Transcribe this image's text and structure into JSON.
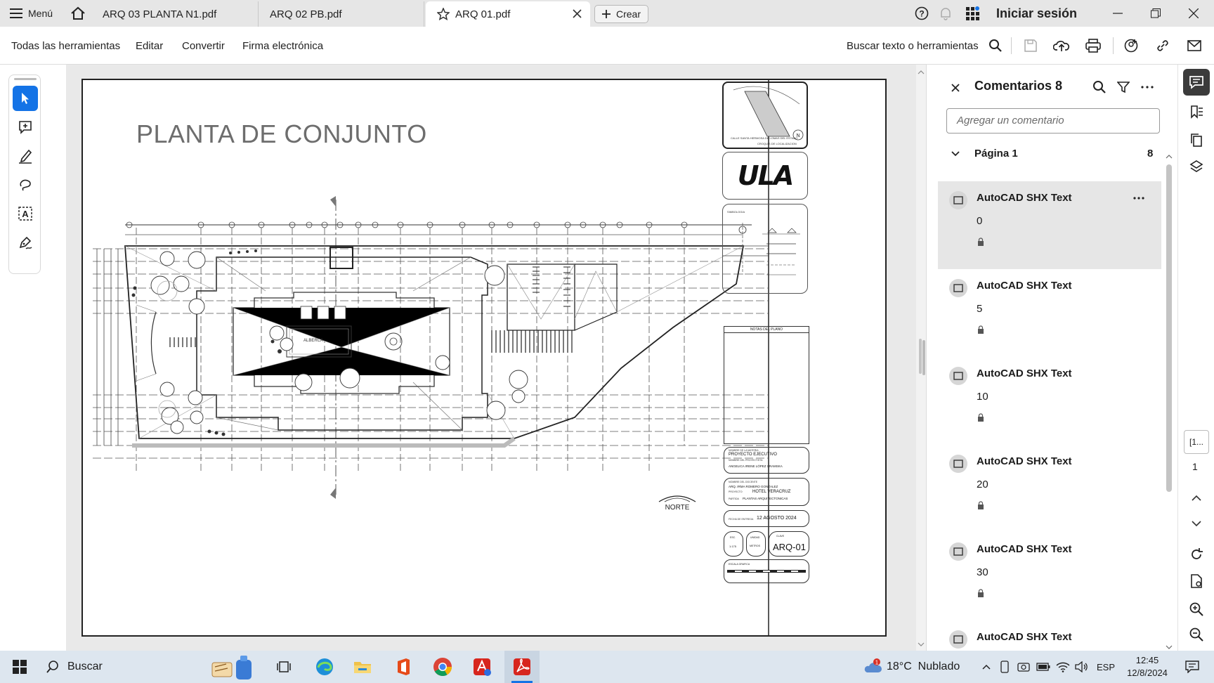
{
  "titlebar": {
    "menu_label": "Menú",
    "tabs": [
      {
        "label": "ARQ 03 PLANTA N1.pdf"
      },
      {
        "label": "ARQ 02  PB.pdf"
      },
      {
        "label": "ARQ 01.pdf"
      }
    ],
    "create_label": "Crear",
    "signin_label": "Iniciar sesión"
  },
  "toolbar": {
    "items": [
      "Todas las herramientas",
      "Editar",
      "Convertir",
      "Firma electrónica"
    ],
    "search_label": "Buscar texto o herramientas"
  },
  "document": {
    "title": "PLANTA DE CONJUNTO",
    "labels": {
      "alberca": "ALBERCA",
      "norte": "NORTE",
      "notas": "NOTAS DEL PLANO",
      "proyecto": "PROYECTO EJECUTIVO",
      "autor": "ANGELICA IRENE LÓPEZ SRAMSKA",
      "docente": "ARQ. IRMA ROMERO GONZALEZ",
      "hotel": "HOTEL VERACRUZ",
      "partida": "PLANTAS ARQUITECTONICAS",
      "fecha": "12 AGOSTO 2024",
      "clave": "ARQ-01",
      "escala": "1:175",
      "unidad": "METROS",
      "brand": "ULA",
      "localizacion": "CROQUIS DE LOCALIZACION",
      "simbologia": "SIMBOLOGIA",
      "calle": "CALLE SANTA HERMOSA DE LOMAS DEL ESTADO",
      "escala_grafica": "ESCALA GRAFICA",
      "nombre_materia": "NOMBRE DE LA MATERIA",
      "nombre_proyectista": "NOMBRE DEL PROYECTISTA",
      "nombre_docente": "NOMBRE DEL DOCENTE",
      "proyecto_lbl": "PROYECTO",
      "partida_lbl": "PARTIDA",
      "fecha_lbl": "FECHA DE ENTREGA",
      "esc_lbl": "ESC.",
      "unidad_lbl": "UNIDAD",
      "clave_lbl": "CLAVE"
    }
  },
  "comments": {
    "title": "Comentarios 8",
    "add_placeholder": "Agregar un comentario",
    "page_label": "Página 1",
    "page_count": "8",
    "items": [
      {
        "author": "AutoCAD SHX Text",
        "text": "0"
      },
      {
        "author": "AutoCAD SHX Text",
        "text": "5"
      },
      {
        "author": "AutoCAD SHX Text",
        "text": "10"
      },
      {
        "author": "AutoCAD SHX Text",
        "text": "20"
      },
      {
        "author": "AutoCAD SHX Text",
        "text": "30"
      },
      {
        "author": "AutoCAD SHX Text",
        "text": ""
      }
    ]
  },
  "rightrail": {
    "page_field": "[1...",
    "page_number": "1"
  },
  "taskbar": {
    "search_label": "Buscar",
    "weather": "18°C  Nublado",
    "language": "ESP",
    "time": "12:45",
    "date": "12/8/2024",
    "notification_badge": "1"
  },
  "colors": {
    "accent": "#1473e6",
    "acrobat_red": "#d7261e"
  }
}
